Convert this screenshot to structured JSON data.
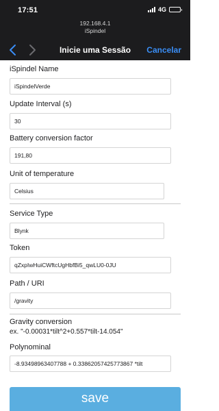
{
  "status_bar": {
    "time": "17:51",
    "network": "4G",
    "battery_level": 1.0
  },
  "browser": {
    "url": "192.168.4.1",
    "site_name": "iSpindel"
  },
  "nav": {
    "back_icon": "chevron-left-icon",
    "forward_icon": "chevron-right-icon",
    "title": "Inicie uma Sessão",
    "cancel_label": "Cancelar"
  },
  "form": {
    "name": {
      "label": "iSpindel Name",
      "value": "iSpindelVerde"
    },
    "update_interval": {
      "label": "Update Interval (s)",
      "value": "30"
    },
    "battery_factor": {
      "label": "Battery conversion factor",
      "value": "191,80"
    },
    "temp_unit": {
      "label": "Unit of temperature",
      "value": "Celsius"
    },
    "service_type": {
      "label": "Service Type",
      "value": "Blynk"
    },
    "token": {
      "label": "Token",
      "value": "qZxpIwHuiCWftcUgHbfBi5_qwLU0-0JU"
    },
    "path": {
      "label": "Path / URI",
      "value": "/gravity"
    },
    "gravity": {
      "label": "Gravity conversion",
      "example": "ex. \"-0.00031*tilt^2+0.557*tilt-14.054\""
    },
    "polynomial": {
      "label": "Polynominal",
      "value": "-8.93498963407788 + 0.33862057425773867 *tilt"
    }
  },
  "save_label": "save",
  "colors": {
    "chrome_bg": "#1c1c1e",
    "accent": "#3a8ef6",
    "save_button": "#5aaee0"
  }
}
